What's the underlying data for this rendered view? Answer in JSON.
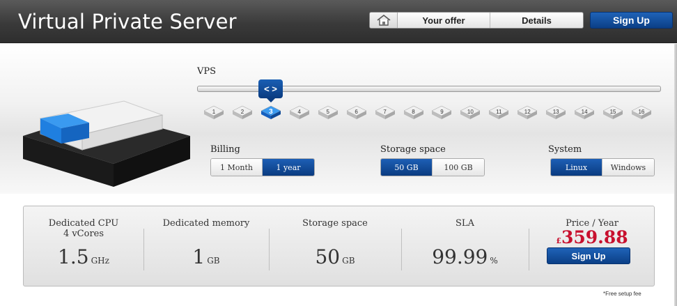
{
  "header": {
    "title": "Virtual Private Server",
    "nav": [
      "Your offer",
      "Details"
    ],
    "signup_label": "Sign Up"
  },
  "vps": {
    "label": "VPS",
    "handle_label": "< >",
    "selected": 3,
    "options": [
      "1",
      "2",
      "3",
      "4",
      "5",
      "6",
      "7",
      "8",
      "9",
      "10",
      "11",
      "12",
      "13",
      "14",
      "15",
      "16"
    ]
  },
  "billing": {
    "label": "Billing",
    "options": [
      "1 Month",
      "1 year"
    ],
    "selected": "1 year"
  },
  "storage": {
    "label": "Storage space",
    "options": [
      "50 GB",
      "100 GB"
    ],
    "selected": "50 GB"
  },
  "system": {
    "label": "System",
    "options": [
      "Linux",
      "Windows"
    ],
    "selected": "Linux"
  },
  "summary": {
    "cpu": {
      "label": "Dedicated CPU",
      "sublabel": "4 vCores",
      "value": "1.5",
      "unit": "GHz"
    },
    "memory": {
      "label": "Dedicated memory",
      "value": "1",
      "unit": "GB"
    },
    "storage": {
      "label": "Storage space",
      "value": "50",
      "unit": "GB"
    },
    "sla": {
      "label": "SLA",
      "value": "99.99",
      "unit": "%"
    },
    "price": {
      "label": "Price / Year",
      "currency": "£",
      "value": "359.88"
    },
    "signup_label": "Sign Up",
    "note": "*Free setup fee"
  },
  "colors": {
    "accent": "#0b3f86",
    "price": "#c8102e",
    "header": "#3a3a3a"
  },
  "icons": {
    "home": "home-icon",
    "handle": "slider-arrows-icon"
  }
}
